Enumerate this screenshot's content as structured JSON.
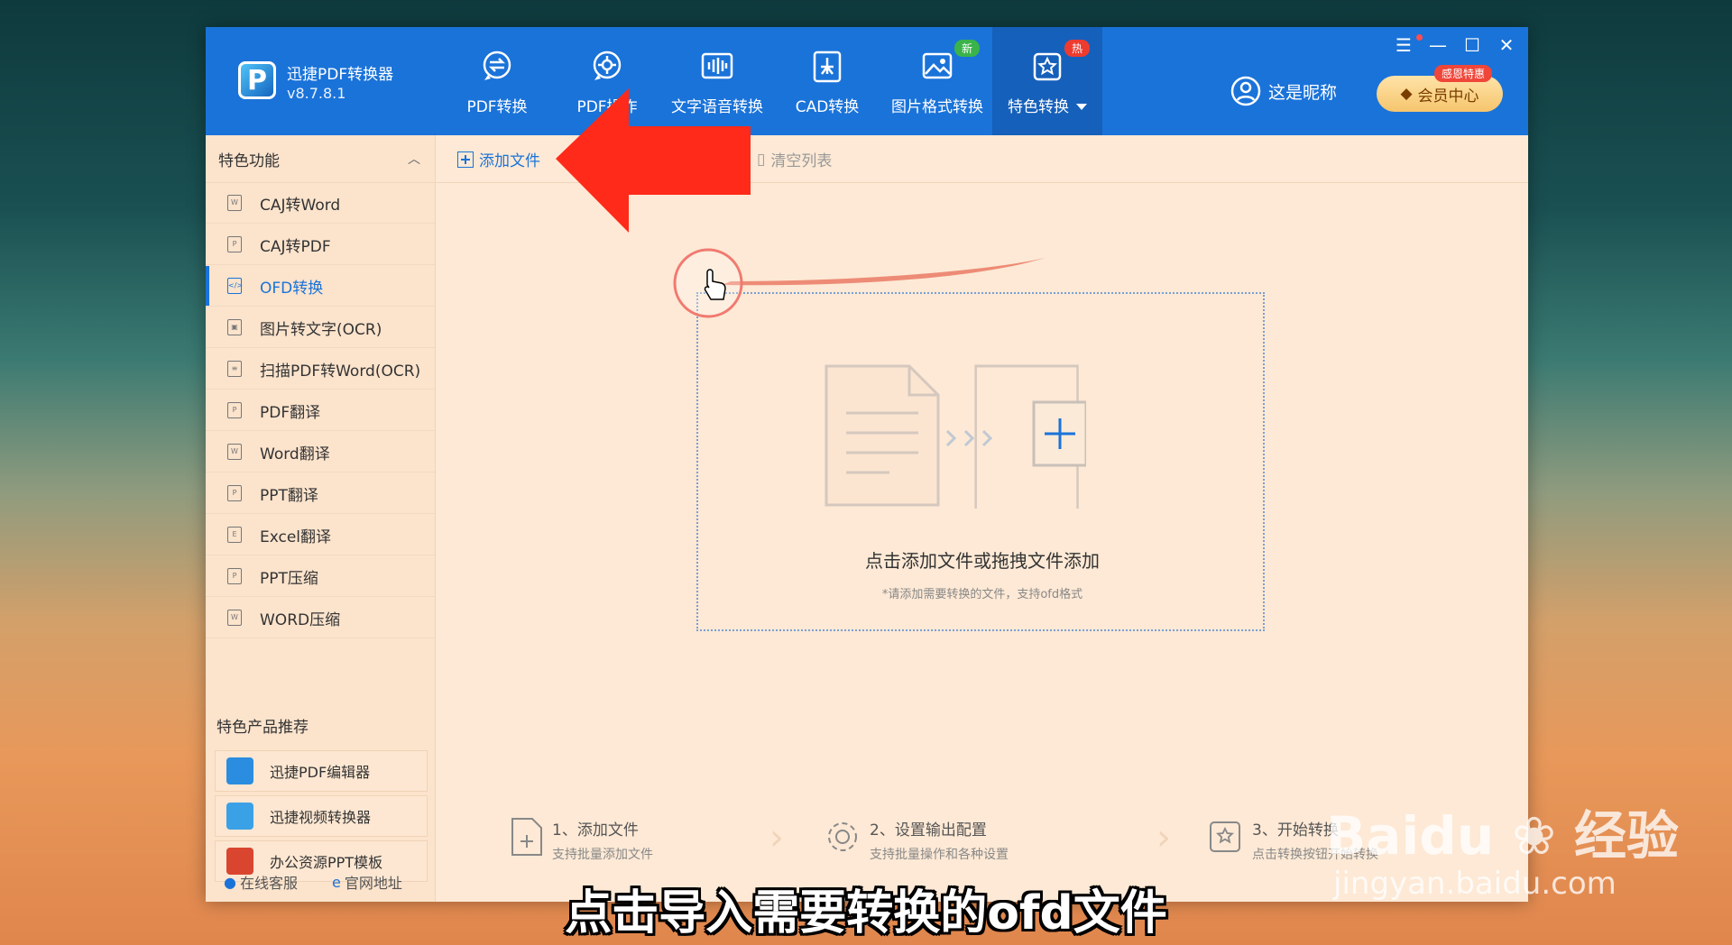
{
  "app": {
    "name": "迅捷PDF转换器",
    "version": "v8.7.8.1"
  },
  "nav": [
    {
      "label": "PDF转换",
      "icon": "pdf-convert-icon"
    },
    {
      "label": "PDF操作",
      "icon": "pdf-operate-icon"
    },
    {
      "label": "文字语音转换",
      "icon": "audio-wave-icon"
    },
    {
      "label": "CAD转换",
      "icon": "cad-icon"
    },
    {
      "label": "图片格式转换",
      "icon": "image-icon",
      "badge": "新"
    },
    {
      "label": "特色转换",
      "icon": "star-convert-icon",
      "badge": "热",
      "active": true
    }
  ],
  "user": {
    "nickname": "这是昵称",
    "vip_label": "会员中心",
    "vip_tag": "感恩特惠"
  },
  "window_controls": {
    "menu": "☰",
    "minimize": "—",
    "maximize": "☐",
    "close": "✕"
  },
  "sidebar": {
    "section_title": "特色功能",
    "items": [
      {
        "label": "CAJ转Word",
        "glyph": "W"
      },
      {
        "label": "CAJ转PDF",
        "glyph": "P"
      },
      {
        "label": "OFD转换",
        "glyph": "</>",
        "active": true
      },
      {
        "label": "图片转文字(OCR)",
        "glyph": "▣"
      },
      {
        "label": "扫描PDF转Word(OCR)",
        "glyph": "≡"
      },
      {
        "label": "PDF翻译",
        "glyph": "P"
      },
      {
        "label": "Word翻译",
        "glyph": "W"
      },
      {
        "label": "PPT翻译",
        "glyph": "P"
      },
      {
        "label": "Excel翻译",
        "glyph": "E"
      },
      {
        "label": "PPT压缩",
        "glyph": "P"
      },
      {
        "label": "WORD压缩",
        "glyph": "W"
      }
    ],
    "recommend_title": "特色产品推荐",
    "recommend": [
      {
        "label": "迅捷PDF编辑器",
        "color": "#2a8de0"
      },
      {
        "label": "迅捷视频转换器",
        "color": "#3ba1e6"
      },
      {
        "label": "办公资源PPT模板",
        "color": "#d9452f"
      }
    ],
    "footer": {
      "service": "在线客服",
      "website": "官网地址"
    }
  },
  "toolbar": {
    "add_file": "添加文件",
    "clear_list": "清空列表"
  },
  "dropzone": {
    "main_text": "点击添加文件或拖拽文件添加",
    "sub_text": "*请添加需要转换的文件，支持ofd格式"
  },
  "steps": [
    {
      "title": "1、添加文件",
      "sub": "支持批量添加文件"
    },
    {
      "title": "2、设置输出配置",
      "sub": "支持批量操作和各种设置"
    },
    {
      "title": "3、开始转换",
      "sub": "点击转换按钮开始转换"
    }
  ],
  "video_subtitle": "点击导入需要转换的ofd文件",
  "watermark": {
    "brand": "Baidu",
    "brand_cn": "经验",
    "url": "jingyan.baidu.com"
  },
  "colors": {
    "primary": "#1a73d9",
    "background": "#fde9d5",
    "arrow": "#ff2a1a"
  }
}
